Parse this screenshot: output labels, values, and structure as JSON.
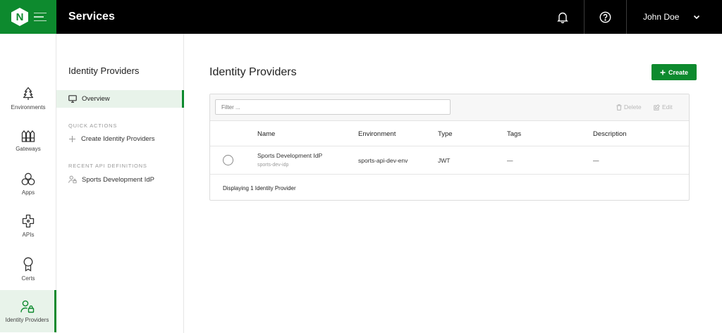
{
  "app": {
    "logo_letter": "N",
    "title": "Services"
  },
  "topbar": {
    "notifications_icon": "bell-icon",
    "help_icon": "help-circle-icon",
    "user_name": "John Doe",
    "user_menu_icon": "chevron-down-icon"
  },
  "rail": {
    "items": [
      {
        "label": "Environments",
        "icon": "tree-icon"
      },
      {
        "label": "Gateways",
        "icon": "gateway-icon"
      },
      {
        "label": "Apps",
        "icon": "apps-icon"
      },
      {
        "label": "APIs",
        "icon": "api-icon"
      },
      {
        "label": "Certs",
        "icon": "certificate-icon"
      },
      {
        "label": "Identity Providers",
        "icon": "user-lock-icon",
        "active": true
      }
    ]
  },
  "subnav": {
    "title": "Identity Providers",
    "overview": "Overview",
    "quick_actions_heading": "QUICK ACTIONS",
    "quick_actions": [
      "Create Identity Providers"
    ],
    "recent_heading": "RECENT API DEFINITIONS",
    "recent": [
      "Sports Development IdP"
    ]
  },
  "main": {
    "title": "Identity Providers",
    "create_label": "Create",
    "filter_placeholder": "Filter ...",
    "delete_label": "Delete",
    "edit_label": "Edit",
    "columns": [
      "Name",
      "Environment",
      "Type",
      "Tags",
      "Description"
    ],
    "rows": [
      {
        "name": "Sports Development IdP",
        "name_sub": "sports-dev-idp",
        "environment": "sports-api-dev-env",
        "type": "JWT",
        "tags": "—",
        "description": "—"
      }
    ],
    "footer": "Displaying 1 Identity Provider"
  },
  "colors": {
    "brand": "#0d8a2e",
    "topbar": "#000000",
    "active_bg": "#e8f3ea"
  }
}
